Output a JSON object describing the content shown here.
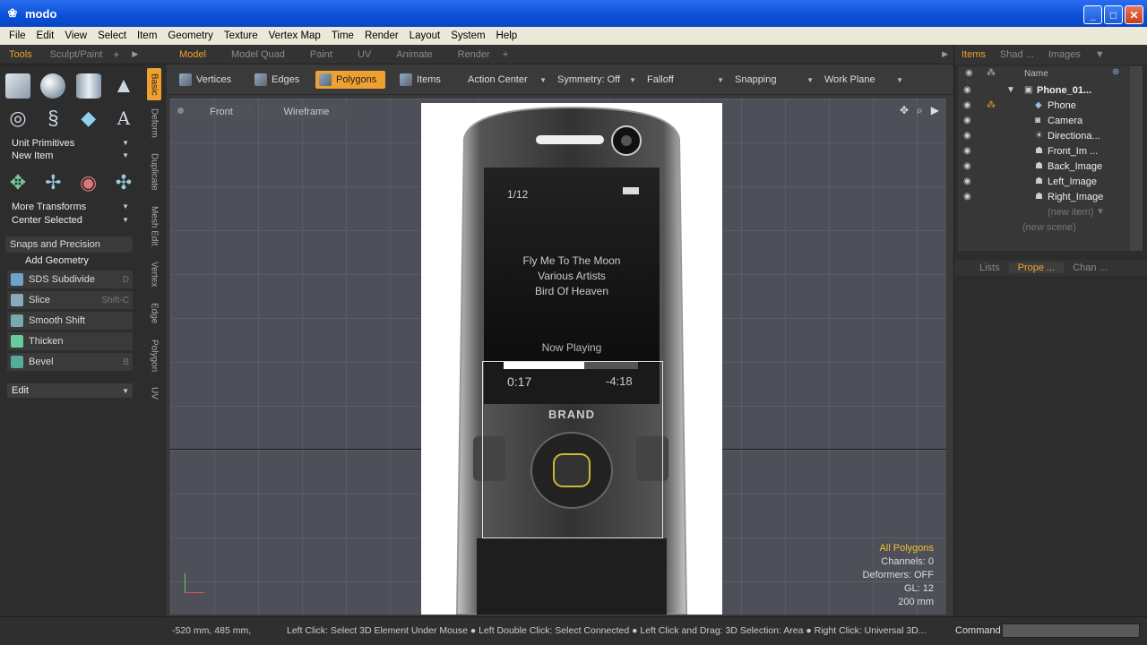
{
  "window": {
    "title": "modo",
    "minimize": "_",
    "maximize": "□",
    "close": "✕"
  },
  "menu": [
    "File",
    "Edit",
    "View",
    "Select",
    "Item",
    "Geometry",
    "Texture",
    "Vertex Map",
    "Time",
    "Render",
    "Layout",
    "System",
    "Help"
  ],
  "left_tabs": [
    "Tools",
    "Sculpt/Paint"
  ],
  "left_tools": {
    "unit_primitives": "Unit Primitives",
    "new_item": "New Item",
    "more_transforms": "More Transforms",
    "center_selected": "Center Selected",
    "snaps": "Snaps and Precision",
    "add_geometry": "Add Geometry",
    "buttons": [
      {
        "label": "SDS Subdivide",
        "key": "D",
        "color": "#6fa3c9"
      },
      {
        "label": "Slice",
        "key": "Shift-C",
        "color": "#8ab"
      },
      {
        "label": "Smooth Shift",
        "key": "",
        "color": "#7aa"
      },
      {
        "label": "Thicken",
        "key": "",
        "color": "#6c9"
      },
      {
        "label": "Bevel",
        "key": "B",
        "color": "#5a9"
      }
    ],
    "edit": "Edit"
  },
  "vertical_tabs": [
    "Basic",
    "Deform",
    "Duplicate",
    "Mesh Edit",
    "Vertex",
    "Edge",
    "Polygon",
    "UV"
  ],
  "main_tabs": [
    "Model",
    "Model Quad",
    "Paint",
    "UV",
    "Animate",
    "Render"
  ],
  "toolbar": {
    "vertices": "Vertices",
    "edges": "Edges",
    "polygons": "Polygons",
    "items": "Items",
    "action_center": "Action Center",
    "symmetry": "Symmetry: Off",
    "falloff": "Falloff",
    "snapping": "Snapping",
    "work_plane": "Work Plane"
  },
  "viewport": {
    "view": "Front",
    "shading": "Wireframe",
    "phone_screen": {
      "track": "1/12",
      "song": "Fly Me To The Moon",
      "artist": "Various Artists",
      "album": "Bird Of Heaven",
      "now_playing": "Now Playing",
      "elapsed": "0:17",
      "remaining": "-4:18",
      "brand": "BRAND",
      "progress": 0.5
    },
    "info": {
      "all_polygons": "All Polygons",
      "channels": "Channels: 0",
      "deformers": "Deformers: OFF",
      "gl": "GL: 12",
      "scale": "200 mm"
    }
  },
  "right_tabs": [
    "Items",
    "Shad ...",
    "Images"
  ],
  "items_list": {
    "header": "Name",
    "rows": [
      {
        "label": "Phone_01...",
        "icon": "scene-icon"
      },
      {
        "label": "Phone",
        "icon": "mesh-icon"
      },
      {
        "label": "Camera",
        "icon": "camera-icon"
      },
      {
        "label": "Directiona...",
        "icon": "light-icon"
      },
      {
        "label": "Front_Im ...",
        "icon": "image-icon"
      },
      {
        "label": "Back_Image",
        "icon": "image-icon"
      },
      {
        "label": "Left_Image",
        "icon": "image-icon"
      },
      {
        "label": "Right_Image",
        "icon": "image-icon"
      }
    ],
    "new_item": "(new item)",
    "new_scene": "(new scene)"
  },
  "prop_tabs": [
    "Lists",
    "Prope ...",
    "Chan ..."
  ],
  "status": {
    "coords": "-520 mm, 485 mm,",
    "hint": "Left Click: Select 3D Element Under Mouse ● Left Double Click: Select Connected ● Left Click and Drag: 3D Selection: Area ● Right Click: Universal 3D...",
    "command": "Command"
  }
}
